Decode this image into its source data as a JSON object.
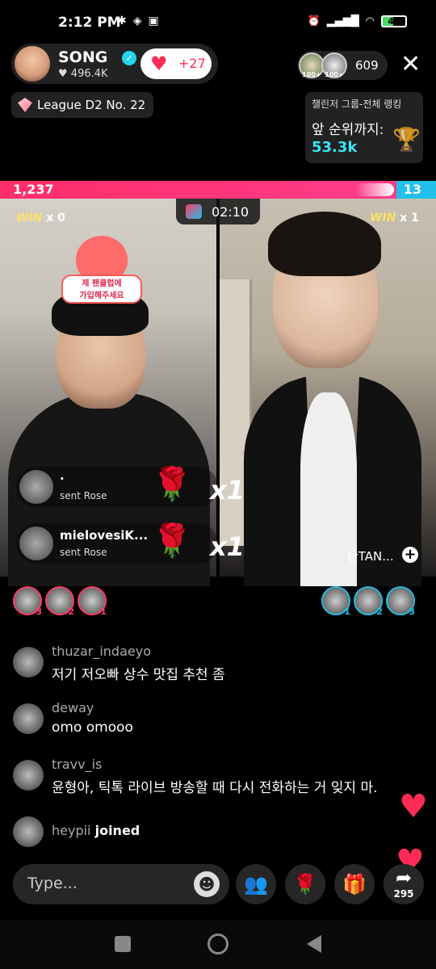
{
  "status_bar": {
    "time": "2:12 PM",
    "battery": "47"
  },
  "host": {
    "name": "SONG",
    "likes": "496.4K",
    "like_increment": "+27"
  },
  "league": {
    "label": "League D2 No. 22"
  },
  "viewers": {
    "count": "609",
    "badge_1": "100+",
    "badge_2": "100+"
  },
  "ranking": {
    "title": "챌린저 그룹-전체 랭킹",
    "subtitle": "앞 순위까지:",
    "value": "53.3k"
  },
  "battle": {
    "left_score": "1,237",
    "right_score": "13",
    "left_share": 0.91,
    "timer": "02:10",
    "left_wins": "WIN",
    "left_win_count": "x 0",
    "right_wins": "WIN",
    "right_win_count": "x 1",
    "sticker_text_1": "제 팬클럽에",
    "sticker_text_2": "가입해주세요",
    "opponent_name": "탄TAN..."
  },
  "gifts": [
    {
      "user": "·",
      "action": "sent Rose",
      "multiplier": "x1"
    },
    {
      "user": "mielovesiK...",
      "action": "sent Rose",
      "multiplier": "x1"
    }
  ],
  "supporters_left": [
    "3",
    "2",
    "1"
  ],
  "supporters_right": [
    "1",
    "2",
    "3"
  ],
  "chat": [
    {
      "user": "thuzar_indaeyo",
      "text": "저기 저오빠 상수 맛집 추천 좀"
    },
    {
      "user": "deway",
      "text": "omo omooo"
    },
    {
      "user": "travv_is",
      "text": "윤형아, 틱톡 라이브 방송할 때 다시 전화하는 거 잊지 마."
    },
    {
      "user": "heypii",
      "text": "joined"
    }
  ],
  "bottom": {
    "input_placeholder": "Type...",
    "share_count": "295"
  },
  "colors": {
    "accent_red": "#fe2c55",
    "accent_cyan": "#20c0e8"
  },
  "icons": {
    "like": "heart-icon",
    "close": "close-icon",
    "emoji": "emoji-icon",
    "team": "team-icon",
    "rose": "rose-icon",
    "gift": "gift-icon",
    "share": "share-icon"
  }
}
